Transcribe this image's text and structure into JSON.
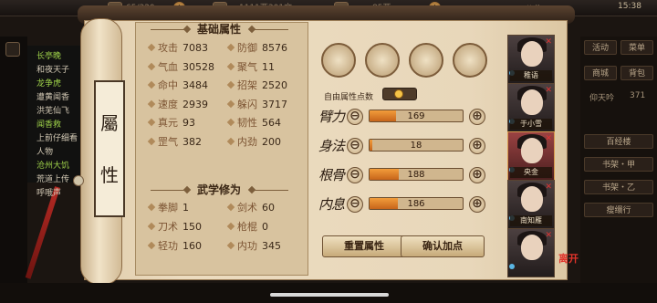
{
  "topbar": {
    "stamina": "65/320",
    "money": "1111两301文",
    "gold": "85两",
    "notice": "公告",
    "time": "15:38"
  },
  "chat": {
    "lines": [
      {
        "text": "长亭晚",
        "highlight": true
      },
      {
        "text": "和夜天子",
        "highlight": false
      },
      {
        "text": "龙争虎",
        "highlight": true
      },
      {
        "text": "遭黄闻香",
        "highlight": false
      },
      {
        "text": "洪芜仙飞",
        "highlight": false
      },
      {
        "text": "闻香救",
        "highlight": true
      },
      {
        "text": "上前仔细看",
        "highlight": false
      },
      {
        "text": "人物",
        "highlight": false
      },
      {
        "text": "沧州大饥",
        "highlight": true
      },
      {
        "text": "荒道上传",
        "highlight": false
      },
      {
        "text": "呼哦声",
        "highlight": false
      }
    ]
  },
  "scroll": {
    "label_top": "屬",
    "label_bottom": "性"
  },
  "basic": {
    "title": "基础属性",
    "stats": [
      {
        "label": "攻击",
        "value": "7083"
      },
      {
        "label": "防御",
        "value": "8576"
      },
      {
        "label": "气血",
        "value": "30528"
      },
      {
        "label": "聚气",
        "value": "11"
      },
      {
        "label": "命中",
        "value": "3484"
      },
      {
        "label": "招架",
        "value": "2520"
      },
      {
        "label": "速度",
        "value": "2939"
      },
      {
        "label": "躲闪",
        "value": "3717"
      },
      {
        "label": "真元",
        "value": "93"
      },
      {
        "label": "韧性",
        "value": "564"
      },
      {
        "label": "罡气",
        "value": "382"
      },
      {
        "label": "内劲",
        "value": "200"
      }
    ]
  },
  "martial": {
    "title": "武学修为",
    "stats": [
      {
        "label": "拳脚",
        "value": "1"
      },
      {
        "label": "剑术",
        "value": "60"
      },
      {
        "label": "刀术",
        "value": "150"
      },
      {
        "label": "枪棍",
        "value": "0"
      },
      {
        "label": "轻功",
        "value": "160"
      },
      {
        "label": "内功",
        "value": "345"
      }
    ]
  },
  "allocation": {
    "free_points_label": "自由属性点数",
    "attributes": [
      {
        "name": "臂力",
        "value": "169",
        "fill": 0.28
      },
      {
        "name": "身法",
        "value": "18",
        "fill": 0.03
      },
      {
        "name": "根骨",
        "value": "188",
        "fill": 0.31
      },
      {
        "name": "内息",
        "value": "186",
        "fill": 0.3
      }
    ],
    "minus": "⊖",
    "plus": "⊕",
    "reset_label": "重置属性",
    "confirm_label": "确认加点"
  },
  "characters": [
    {
      "name": "稚语",
      "selected": false
    },
    {
      "name": "于小雪",
      "selected": false
    },
    {
      "name": "央金",
      "selected": true
    },
    {
      "name": "南知雁",
      "selected": false
    },
    {
      "name": "",
      "selected": false
    }
  ],
  "leave_badge": "离开",
  "right_menu": {
    "row1": [
      "活动",
      "菜单"
    ],
    "row2": [
      "商城",
      "背包"
    ],
    "info": "仰天吟",
    "info_num": "371",
    "buttons": [
      "百经楼",
      "书架・甲",
      "书架・乙",
      "瘦缳行"
    ]
  },
  "colors": {
    "paper": "#e8d7ba",
    "bar_fill": "#e07f2a",
    "accent_red": "#e0332a"
  }
}
